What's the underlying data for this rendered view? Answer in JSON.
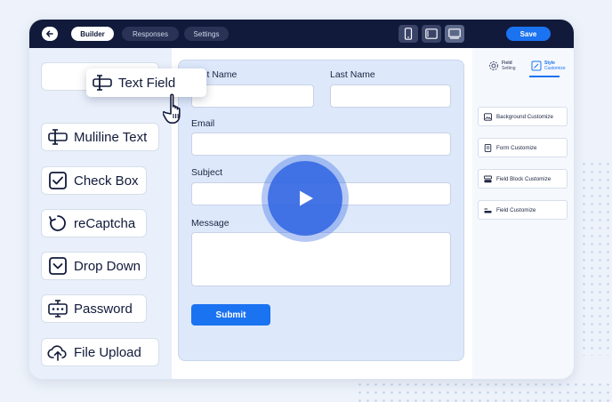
{
  "topbar": {
    "tabs": [
      {
        "label": "Builder",
        "active": true
      },
      {
        "label": "Responses",
        "active": false
      },
      {
        "label": "Settings",
        "active": false
      }
    ],
    "devices": [
      "mobile-icon",
      "tablet-icon",
      "desktop-icon"
    ],
    "active_device": "desktop-icon",
    "save_label": "Save"
  },
  "field_types": [
    {
      "label": "Muliline Text",
      "icon": "multiline-text-icon"
    },
    {
      "label": "Check Box",
      "icon": "checkbox-icon"
    },
    {
      "label": "reCaptcha",
      "icon": "recaptcha-icon"
    },
    {
      "label": "Drop Down",
      "icon": "dropdown-icon"
    },
    {
      "label": "Password",
      "icon": "password-icon"
    },
    {
      "label": "File Upload",
      "icon": "file-upload-icon"
    }
  ],
  "dragging_field": {
    "label": "Text Field",
    "icon": "text-field-icon"
  },
  "form": {
    "first_name_label": "First Name",
    "last_name_label": "Last Name",
    "email_label": "Email",
    "subject_label": "Subject",
    "message_label": "Message",
    "submit_label": "Submit"
  },
  "right_panel": {
    "tabs": [
      {
        "label_line1": "Field",
        "label_line2": "Setting",
        "active": false
      },
      {
        "label_line1": "Style",
        "label_line2": "Customize",
        "active": true
      }
    ],
    "buttons": [
      {
        "label": "Background Customize",
        "icon": "image-icon"
      },
      {
        "label": "Form Customize",
        "icon": "form-icon"
      },
      {
        "label": "Field Block Customize",
        "icon": "field-block-icon"
      },
      {
        "label": "Field Customize",
        "icon": "field-icon"
      }
    ]
  },
  "colors": {
    "topbar": "#111a3a",
    "accent": "#1a73f0",
    "form_bg": "#dde8fb"
  }
}
